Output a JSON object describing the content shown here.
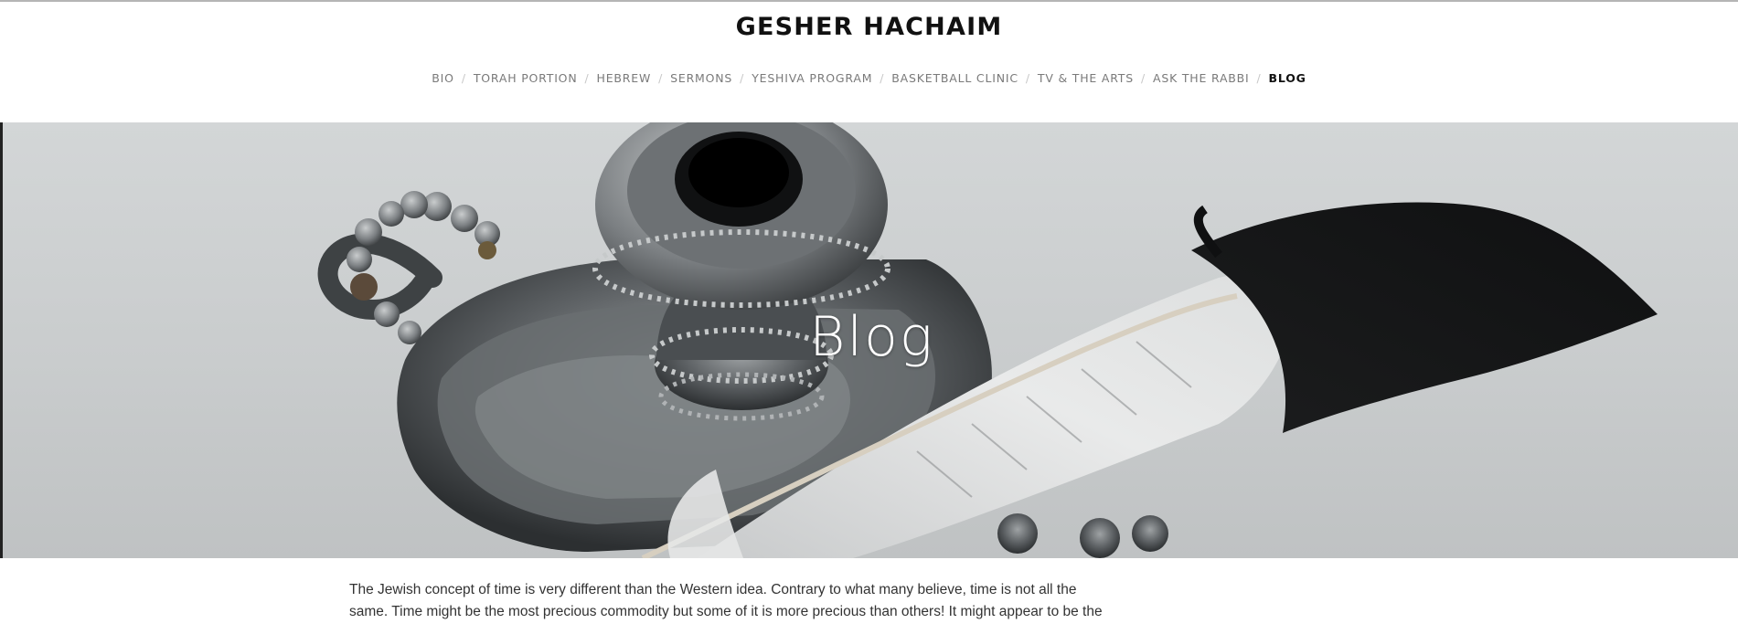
{
  "site": {
    "title": "GESHER HACHAIM"
  },
  "nav": {
    "items": [
      {
        "label": "BIO"
      },
      {
        "label": "TORAH PORTION"
      },
      {
        "label": "HEBREW"
      },
      {
        "label": "SERMONS"
      },
      {
        "label": "YESHIVA PROGRAM"
      },
      {
        "label": "BASKETBALL CLINIC"
      },
      {
        "label": "TV & THE ARTS"
      },
      {
        "label": "ASK THE RABBI"
      },
      {
        "label": "BLOG"
      }
    ],
    "separator": "/",
    "active_index": 8
  },
  "hero": {
    "title": "Blog",
    "image_icon": "inkwell-and-quill-photo"
  },
  "content": {
    "paragraph": "The Jewish concept of time is very different than the Western idea. Contrary to what many believe, time is not all the same. Time might be the most precious commodity but some of it is more precious than others!  It might appear to be the"
  },
  "colors": {
    "title": "#111111",
    "nav_text": "#7a7a7a",
    "nav_active": "#111111",
    "body_text": "#333333"
  }
}
